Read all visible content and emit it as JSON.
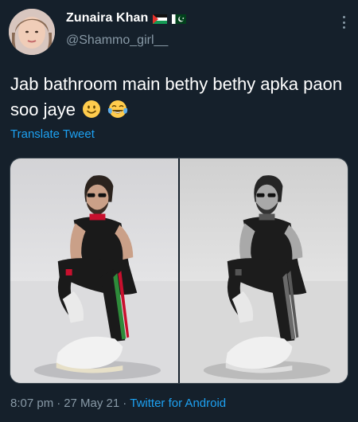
{
  "author": {
    "display_name": "Zunaira Khan",
    "handle": "@Shammo_girl__",
    "flags": [
      "palestine-flag-icon",
      "pakistan-flag-icon"
    ]
  },
  "tweet": {
    "text": "Jab bathroom main bethy bethy apka paon soo jaye",
    "emojis": [
      "slightly-smiling-face-icon",
      "face-with-tears-of-joy-icon"
    ],
    "translate_label": "Translate Tweet"
  },
  "media": {
    "photos": [
      {
        "name": "color-photo"
      },
      {
        "name": "grayscale-photo"
      }
    ]
  },
  "meta": {
    "time": "8:07 pm",
    "date": "27 May 21",
    "source": "Twitter for Android"
  },
  "colors": {
    "background": "#15202b",
    "secondary_text": "#8899a6",
    "link": "#1da1f2"
  }
}
